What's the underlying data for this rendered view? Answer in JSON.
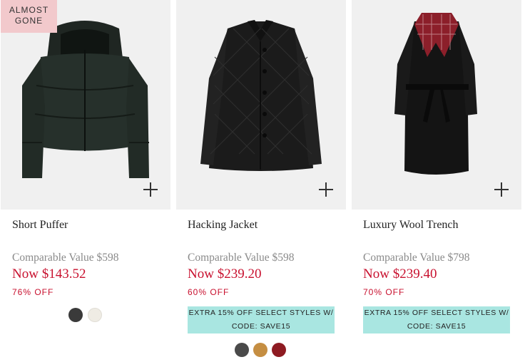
{
  "products": [
    {
      "badge": "ALMOST GONE",
      "name": "Short Puffer",
      "comparable": "Comparable Value $598",
      "now": "Now $143.52",
      "off": "76% OFF",
      "promo": "",
      "swatch_colors": [
        "#3a3a3a",
        "#efece4"
      ],
      "add_icon": "plus-icon"
    },
    {
      "badge": "",
      "name": "Hacking Jacket",
      "comparable": "Comparable Value $598",
      "now": "Now $239.20",
      "off": "60% OFF",
      "promo": "EXTRA 15% OFF SELECT STYLES W/ CODE: SAVE15",
      "swatch_colors": [
        "#4a4a4a",
        "#c58e42",
        "#8e1b22"
      ],
      "add_icon": "plus-icon"
    },
    {
      "badge": "",
      "name": "Luxury Wool Trench",
      "comparable": "Comparable Value $798",
      "now": "Now $239.40",
      "off": "70% OFF",
      "promo": "EXTRA 15% OFF SELECT STYLES W/ CODE: SAVE15",
      "swatch_colors": [],
      "add_icon": "plus-icon"
    }
  ],
  "colors": {
    "sale_red": "#c8102e",
    "promo_bg": "#a9e6e1",
    "badge_bg": "#f2c9cc",
    "image_bg": "#f0f0f0"
  }
}
